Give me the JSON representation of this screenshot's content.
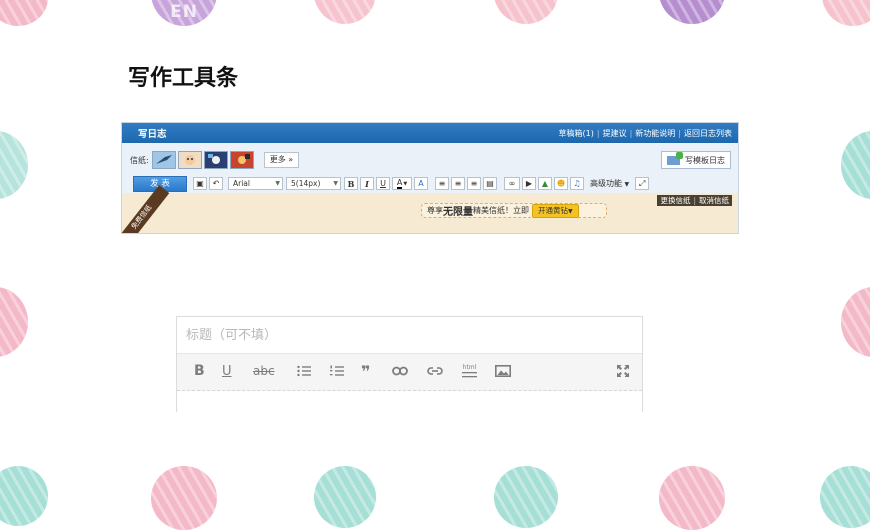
{
  "page_title": "写作工具条",
  "decor": {
    "en_badge": "EN",
    "colors": {
      "purple": "#c7a4da",
      "pink": "#f4b9c8",
      "mint": "#a6dfd6",
      "dark_purple": "#b58ed0"
    }
  },
  "old_editor": {
    "header_title": "写日志",
    "header_links": [
      "草稿箱(1)",
      "提建议",
      "新功能说明",
      "返回日志列表"
    ],
    "paper_label": "信纸:",
    "more_label": "更多",
    "template_button": "写模板日志",
    "publish_label": "发 表",
    "font_family_value": "Arial",
    "font_size_value": "5(14px)",
    "advanced_label": "高级功能",
    "ribbon_text": "免费信纸",
    "promo": {
      "prefix": "尊享",
      "highlight": "无限量",
      "suffix": "精美信纸！立即",
      "button": "开通黄钻"
    },
    "paper_actions": [
      "更换信纸",
      "取消信纸"
    ],
    "colors": {
      "header_blue": "#2572bb",
      "publish_blue": "#3a8ad8",
      "body_bg": "#f7ead2"
    }
  },
  "new_editor": {
    "title_placeholder": "标题（可不填）",
    "html_label": "html"
  }
}
